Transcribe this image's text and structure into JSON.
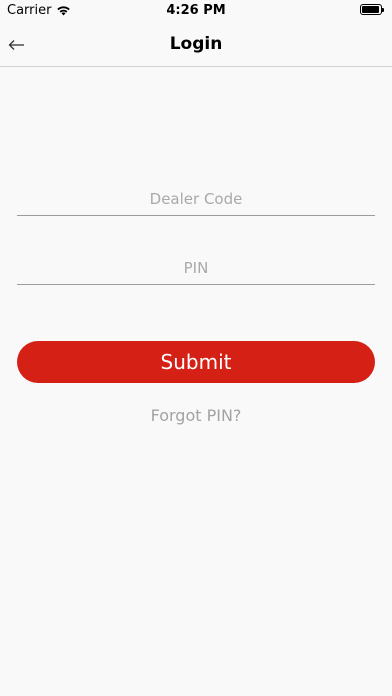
{
  "status_bar": {
    "carrier": "Carrier",
    "time": "4:26 PM",
    "wifi_icon": "wifi-icon",
    "battery_icon": "battery-icon"
  },
  "nav": {
    "back_icon": "arrow-left-icon",
    "title": "Login"
  },
  "form": {
    "dealer_code": {
      "placeholder": "Dealer Code",
      "value": ""
    },
    "pin": {
      "placeholder": "PIN",
      "value": ""
    },
    "submit_label": "Submit",
    "forgot_label": "Forgot PIN?"
  },
  "colors": {
    "accent": "#d52016",
    "background": "#f9f9f9",
    "placeholder": "#a9a9a9",
    "link": "#a3a3a3"
  }
}
